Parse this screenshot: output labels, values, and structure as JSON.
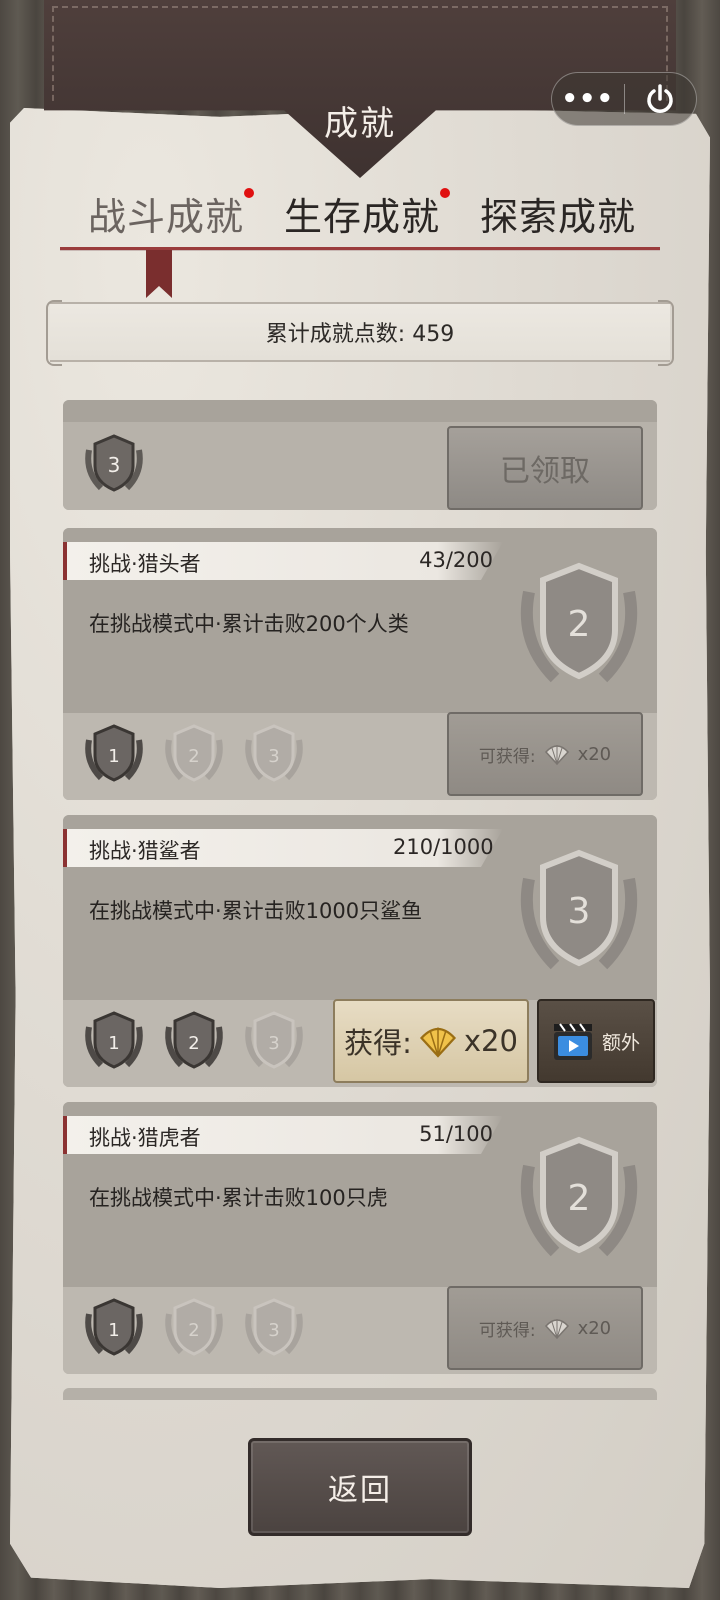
{
  "header": {
    "title": "成就"
  },
  "capsule": {
    "more_icon": "more-dots-icon",
    "power_icon": "power-icon"
  },
  "tabs": [
    {
      "label": "战斗成就",
      "active": true,
      "has_dot": true
    },
    {
      "label": "生存成就",
      "active": false,
      "has_dot": true
    },
    {
      "label": "探索成就",
      "active": false,
      "has_dot": false
    }
  ],
  "points": {
    "text": "累计成就点数: 459"
  },
  "cards": [
    {
      "badge_level": "3",
      "button_label": "已领取"
    },
    {
      "title": "挑战·猎头者",
      "progress": "43/200",
      "description": "在挑战模式中·累计击败200个人类",
      "big_badge": "2",
      "small_badges": [
        "1",
        "2",
        "3"
      ],
      "earned_count": 1,
      "reward_label": "可获得:",
      "reward_count": "x20"
    },
    {
      "title": "挑战·猎鲨者",
      "progress": "210/1000",
      "description": "在挑战模式中·累计击败1000只鲨鱼",
      "big_badge": "3",
      "small_badges": [
        "1",
        "2",
        "3"
      ],
      "earned_count": 2,
      "reward_label": "获得:",
      "reward_count": "x20",
      "extra_label": "额外"
    },
    {
      "title": "挑战·猎虎者",
      "progress": "51/100",
      "description": "在挑战模式中·累计击败100只虎",
      "big_badge": "2",
      "small_badges": [
        "1",
        "2",
        "3"
      ],
      "earned_count": 1,
      "reward_label": "可获得:",
      "reward_count": "x20"
    }
  ],
  "back_button": {
    "label": "返回"
  },
  "colors": {
    "accent_red": "#8b3232",
    "notify_dot": "#e01010",
    "leather": "#4a3c39",
    "gold": "#d6c7a4"
  }
}
